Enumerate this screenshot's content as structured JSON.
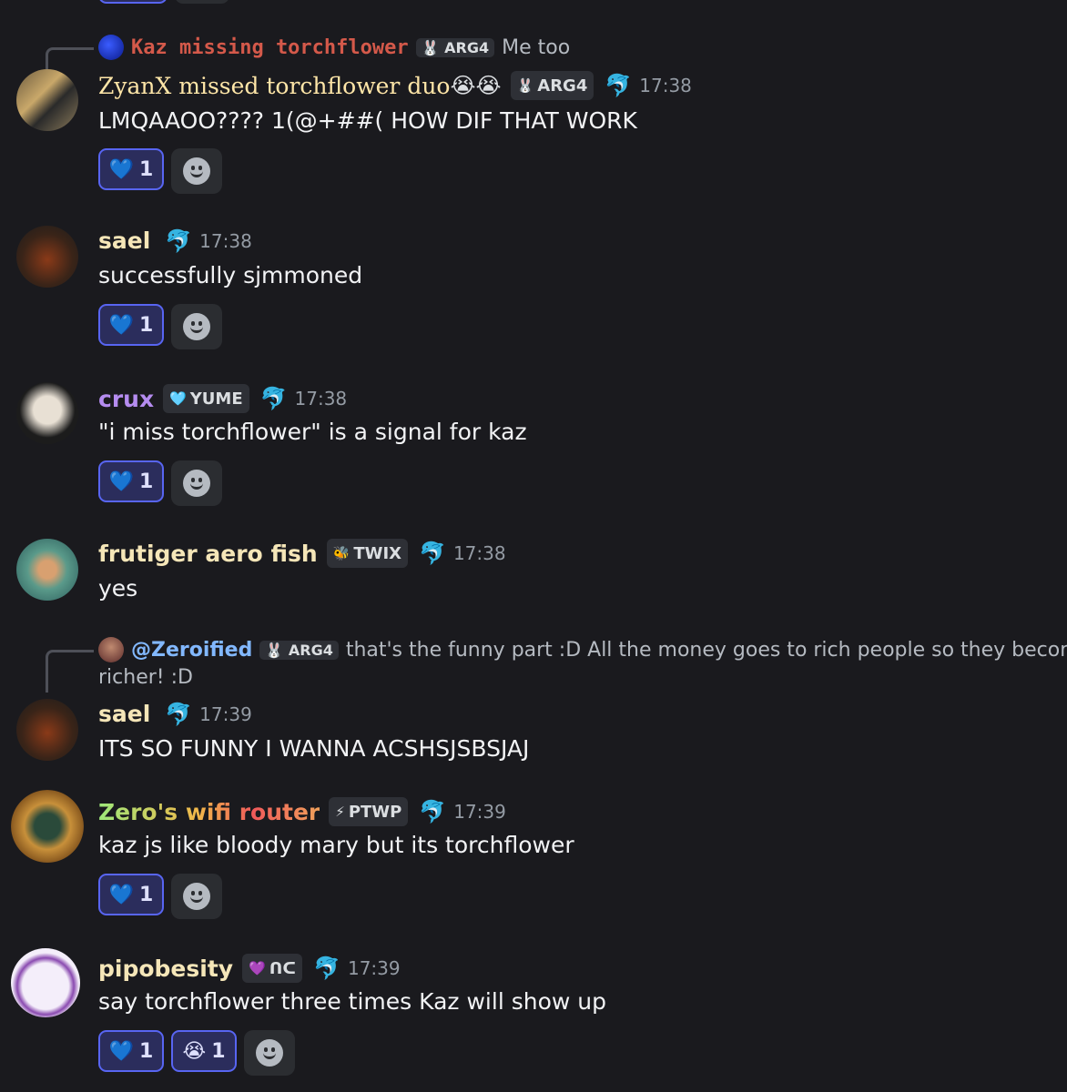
{
  "colors": {
    "background": "#1a1a1e",
    "reaction_bg": "#2b2d5c",
    "reaction_border": "#5865f2",
    "timestamp": "#949ba4"
  },
  "reply1": {
    "author": "Kaz missing torchflower",
    "tag": "ARG4",
    "text": "Me too"
  },
  "messages": [
    {
      "author": "ZyanX missed torchflower duo",
      "author_emoji": "😭😭",
      "tag": "ARG4",
      "tag_icon": "🐰",
      "time": "17:38",
      "text": "LMQAAOO???? 1(@+##( HOW DIF THAT WORK",
      "reactions": [
        {
          "emoji": "💙",
          "count": "1"
        }
      ]
    },
    {
      "author": "sael",
      "time": "17:38",
      "text": "successfully sjmmoned",
      "reactions": [
        {
          "emoji": "💙",
          "count": "1"
        }
      ]
    },
    {
      "author": "crux",
      "tag": "YUME",
      "tag_icon": "🩵",
      "time": "17:38",
      "text": "\"i miss torchflower\" is a signal for kaz",
      "reactions": [
        {
          "emoji": "💙",
          "count": "1"
        }
      ]
    },
    {
      "author": "frutiger aero fish",
      "tag": "TWIX",
      "tag_icon": "🐝",
      "time": "17:38",
      "text": "yes"
    },
    {
      "author": "sael",
      "time": "17:39",
      "text": "ITS SO FUNNY I WANNA ACSHSJSBSJAJ"
    },
    {
      "author": "Zero's wifi router",
      "tag": "PTWP",
      "tag_icon": "⚡",
      "time": "17:39",
      "text": "kaz js like bloody mary but its torchflower",
      "reactions": [
        {
          "emoji": "💙",
          "count": "1"
        }
      ]
    },
    {
      "author": "pipobesity",
      "tag": "ᑎᑕ",
      "tag_icon": "💜",
      "time": "17:39",
      "text": "say torchflower three times Kaz will show up",
      "reactions": [
        {
          "emoji": "💙",
          "count": "1"
        },
        {
          "emoji": "😭",
          "count": "1"
        }
      ]
    }
  ],
  "reply2": {
    "author": "@Zeroified",
    "tag": "ARG4",
    "text_line1": "that's the funny part :D All the money goes to rich people so they become",
    "text_line2": "richer! :D"
  },
  "icons": {
    "dolphin": "🐬",
    "add_reaction": "smile-plus-icon"
  }
}
